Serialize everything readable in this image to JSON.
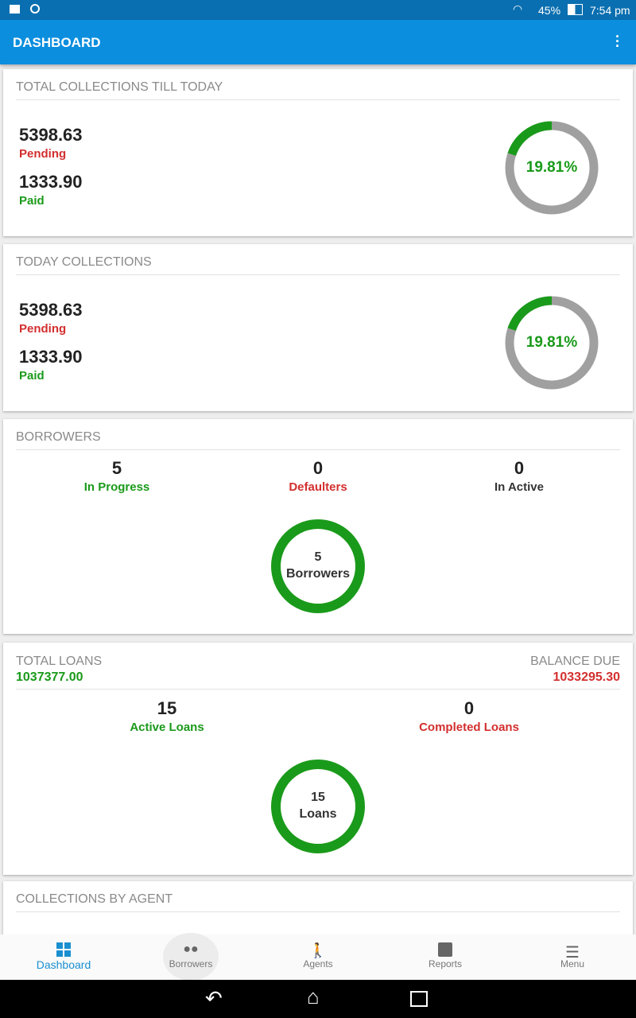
{
  "status_bar": {
    "battery": "45%",
    "time": "7:54 pm"
  },
  "app_bar": {
    "title": "DASHBOARD"
  },
  "total_collections": {
    "title": "TOTAL COLLECTIONS TILL TODAY",
    "pending_value": "5398.63",
    "pending_label": "Pending",
    "paid_value": "1333.90",
    "paid_label": "Paid",
    "percent_label": "19.81%",
    "percent": 19.81
  },
  "today_collections": {
    "title": "TODAY COLLECTIONS",
    "pending_value": "5398.63",
    "pending_label": "Pending",
    "paid_value": "1333.90",
    "paid_label": "Paid",
    "percent_label": "19.81%",
    "percent": 19.81
  },
  "borrowers": {
    "title": "BORROWERS",
    "stats": [
      {
        "value": "5",
        "label": "In Progress"
      },
      {
        "value": "0",
        "label": "Defaulters"
      },
      {
        "value": "0",
        "label": "In Active"
      }
    ],
    "donut_value": "5",
    "donut_label": "Borrowers"
  },
  "loans": {
    "total_label": "TOTAL LOANS",
    "total_value": "1037377.00",
    "balance_label": "BALANCE DUE",
    "balance_value": "1033295.30",
    "stats": [
      {
        "value": "15",
        "label": "Active Loans"
      },
      {
        "value": "0",
        "label": "Completed Loans"
      }
    ],
    "donut_value": "15",
    "donut_label": "Loans"
  },
  "agents": {
    "title": "COLLECTIONS BY AGENT"
  },
  "bottom_nav": [
    {
      "label": "Dashboard",
      "icon": "dashboard-icon"
    },
    {
      "label": "Borrowers",
      "icon": "people-icon"
    },
    {
      "label": "Agents",
      "icon": "agent-icon"
    },
    {
      "label": "Reports",
      "icon": "reports-icon"
    },
    {
      "label": "Menu",
      "icon": "menu-icon"
    }
  ],
  "colors": {
    "accent": "#0b8ede",
    "green": "#1a9a1a",
    "red": "#d32f2f",
    "ring_gray": "#a0a0a0"
  }
}
